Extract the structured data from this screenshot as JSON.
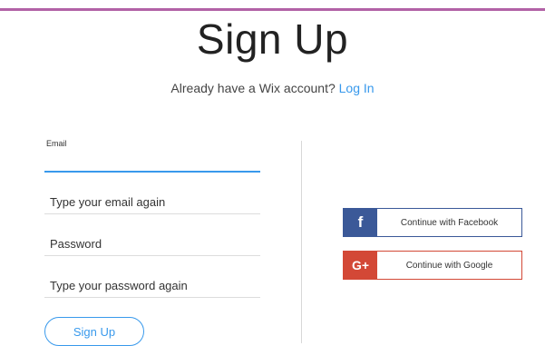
{
  "header": {
    "title": "Sign Up",
    "subtitle_text": "Already have a Wix account?",
    "login_link": "Log In"
  },
  "form": {
    "email_label": "Email",
    "email_placeholder": "",
    "email_again_placeholder": "Type your email again",
    "password_placeholder": "Password",
    "password_again_placeholder": "Type your password again",
    "signup_button": "Sign Up"
  },
  "social": {
    "facebook_label": "Continue with Facebook",
    "google_label": "Continue with Google",
    "facebook_icon": "facebook-icon",
    "google_icon": "google-plus-icon"
  },
  "colors": {
    "accent": "#3899ec",
    "top_bar": "#b262a6",
    "facebook": "#3b5998",
    "google": "#d34836"
  }
}
